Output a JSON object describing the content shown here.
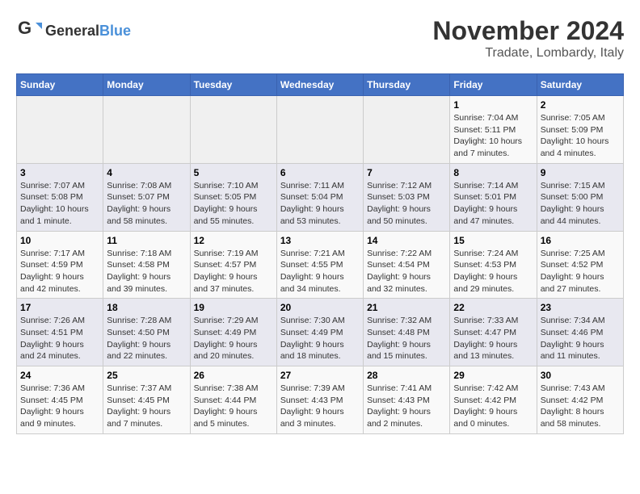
{
  "header": {
    "logo": {
      "general": "General",
      "blue": "Blue"
    },
    "title": "November 2024",
    "location": "Tradate, Lombardy, Italy"
  },
  "calendar": {
    "weekdays": [
      "Sunday",
      "Monday",
      "Tuesday",
      "Wednesday",
      "Thursday",
      "Friday",
      "Saturday"
    ],
    "weeks": [
      [
        {
          "day": "",
          "info": ""
        },
        {
          "day": "",
          "info": ""
        },
        {
          "day": "",
          "info": ""
        },
        {
          "day": "",
          "info": ""
        },
        {
          "day": "",
          "info": ""
        },
        {
          "day": "1",
          "info": "Sunrise: 7:04 AM\nSunset: 5:11 PM\nDaylight: 10 hours and 7 minutes."
        },
        {
          "day": "2",
          "info": "Sunrise: 7:05 AM\nSunset: 5:09 PM\nDaylight: 10 hours and 4 minutes."
        }
      ],
      [
        {
          "day": "3",
          "info": "Sunrise: 7:07 AM\nSunset: 5:08 PM\nDaylight: 10 hours and 1 minute."
        },
        {
          "day": "4",
          "info": "Sunrise: 7:08 AM\nSunset: 5:07 PM\nDaylight: 9 hours and 58 minutes."
        },
        {
          "day": "5",
          "info": "Sunrise: 7:10 AM\nSunset: 5:05 PM\nDaylight: 9 hours and 55 minutes."
        },
        {
          "day": "6",
          "info": "Sunrise: 7:11 AM\nSunset: 5:04 PM\nDaylight: 9 hours and 53 minutes."
        },
        {
          "day": "7",
          "info": "Sunrise: 7:12 AM\nSunset: 5:03 PM\nDaylight: 9 hours and 50 minutes."
        },
        {
          "day": "8",
          "info": "Sunrise: 7:14 AM\nSunset: 5:01 PM\nDaylight: 9 hours and 47 minutes."
        },
        {
          "day": "9",
          "info": "Sunrise: 7:15 AM\nSunset: 5:00 PM\nDaylight: 9 hours and 44 minutes."
        }
      ],
      [
        {
          "day": "10",
          "info": "Sunrise: 7:17 AM\nSunset: 4:59 PM\nDaylight: 9 hours and 42 minutes."
        },
        {
          "day": "11",
          "info": "Sunrise: 7:18 AM\nSunset: 4:58 PM\nDaylight: 9 hours and 39 minutes."
        },
        {
          "day": "12",
          "info": "Sunrise: 7:19 AM\nSunset: 4:57 PM\nDaylight: 9 hours and 37 minutes."
        },
        {
          "day": "13",
          "info": "Sunrise: 7:21 AM\nSunset: 4:55 PM\nDaylight: 9 hours and 34 minutes."
        },
        {
          "day": "14",
          "info": "Sunrise: 7:22 AM\nSunset: 4:54 PM\nDaylight: 9 hours and 32 minutes."
        },
        {
          "day": "15",
          "info": "Sunrise: 7:24 AM\nSunset: 4:53 PM\nDaylight: 9 hours and 29 minutes."
        },
        {
          "day": "16",
          "info": "Sunrise: 7:25 AM\nSunset: 4:52 PM\nDaylight: 9 hours and 27 minutes."
        }
      ],
      [
        {
          "day": "17",
          "info": "Sunrise: 7:26 AM\nSunset: 4:51 PM\nDaylight: 9 hours and 24 minutes."
        },
        {
          "day": "18",
          "info": "Sunrise: 7:28 AM\nSunset: 4:50 PM\nDaylight: 9 hours and 22 minutes."
        },
        {
          "day": "19",
          "info": "Sunrise: 7:29 AM\nSunset: 4:49 PM\nDaylight: 9 hours and 20 minutes."
        },
        {
          "day": "20",
          "info": "Sunrise: 7:30 AM\nSunset: 4:49 PM\nDaylight: 9 hours and 18 minutes."
        },
        {
          "day": "21",
          "info": "Sunrise: 7:32 AM\nSunset: 4:48 PM\nDaylight: 9 hours and 15 minutes."
        },
        {
          "day": "22",
          "info": "Sunrise: 7:33 AM\nSunset: 4:47 PM\nDaylight: 9 hours and 13 minutes."
        },
        {
          "day": "23",
          "info": "Sunrise: 7:34 AM\nSunset: 4:46 PM\nDaylight: 9 hours and 11 minutes."
        }
      ],
      [
        {
          "day": "24",
          "info": "Sunrise: 7:36 AM\nSunset: 4:45 PM\nDaylight: 9 hours and 9 minutes."
        },
        {
          "day": "25",
          "info": "Sunrise: 7:37 AM\nSunset: 4:45 PM\nDaylight: 9 hours and 7 minutes."
        },
        {
          "day": "26",
          "info": "Sunrise: 7:38 AM\nSunset: 4:44 PM\nDaylight: 9 hours and 5 minutes."
        },
        {
          "day": "27",
          "info": "Sunrise: 7:39 AM\nSunset: 4:43 PM\nDaylight: 9 hours and 3 minutes."
        },
        {
          "day": "28",
          "info": "Sunrise: 7:41 AM\nSunset: 4:43 PM\nDaylight: 9 hours and 2 minutes."
        },
        {
          "day": "29",
          "info": "Sunrise: 7:42 AM\nSunset: 4:42 PM\nDaylight: 9 hours and 0 minutes."
        },
        {
          "day": "30",
          "info": "Sunrise: 7:43 AM\nSunset: 4:42 PM\nDaylight: 8 hours and 58 minutes."
        }
      ]
    ]
  }
}
